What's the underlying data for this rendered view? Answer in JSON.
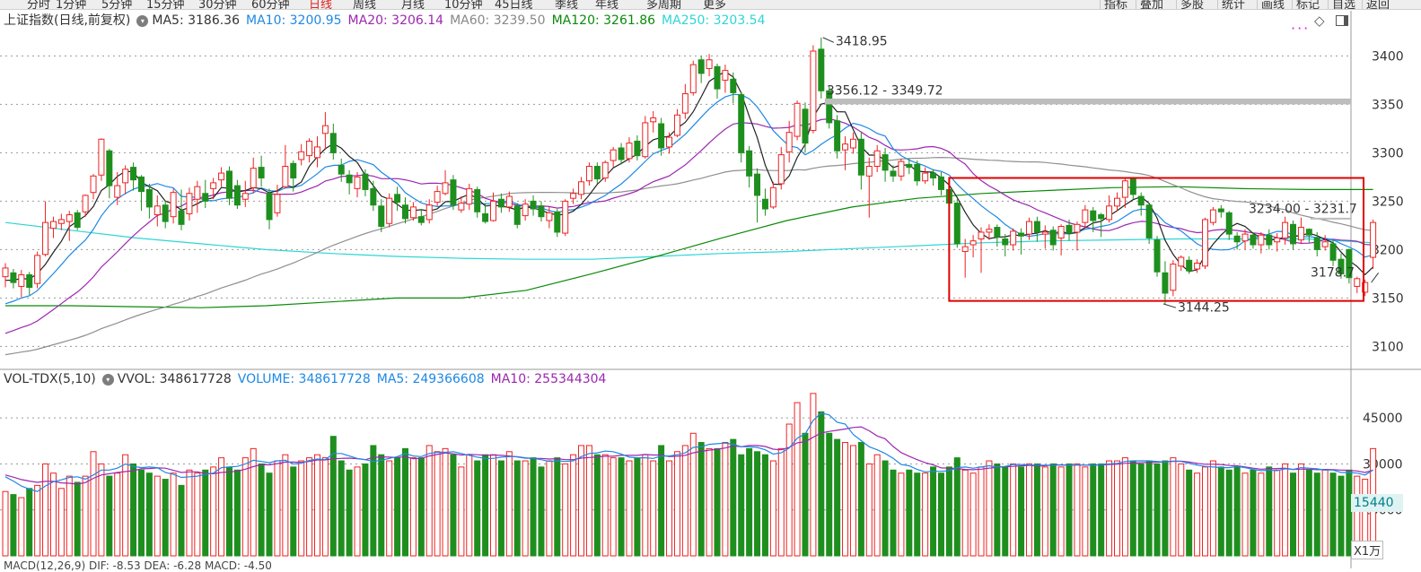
{
  "toolbar": {
    "tabs": [
      "分时",
      "1分钟",
      "5分钟",
      "15分钟",
      "30分钟",
      "60分钟",
      "日线",
      "周线",
      "月线",
      "10分钟",
      "45日线",
      "季线",
      "年线",
      "多周期",
      "更多"
    ],
    "active_tab": "日线",
    "right_buttons": [
      "指标",
      "叠加",
      "多股",
      "统计",
      "画线",
      "标记",
      "自选",
      "返回"
    ]
  },
  "price_panel": {
    "legend": [
      {
        "text": "上证指数(日线,前复权)",
        "color": "#333333"
      },
      {
        "text": "MA5: 3186.36",
        "color": "#333333"
      },
      {
        "text": "MA10: 3200.95",
        "color": "#1e88e5"
      },
      {
        "text": "MA20: 3206.14",
        "color": "#9c27b0"
      },
      {
        "text": "MA60: 3239.50",
        "color": "#888888"
      },
      {
        "text": "MA120: 3261.86",
        "color": "#0a8a0a"
      },
      {
        "text": "MA250: 3203.54",
        "color": "#2ed5d5"
      }
    ],
    "ticks": [
      "3400",
      "3350",
      "3300",
      "3250",
      "3200",
      "3150",
      "3100"
    ],
    "annotations": {
      "high": "3418.95",
      "gap_upper": "3356.12 - 3349.72",
      "gap_right": "3234.00 - 3231.7",
      "low": "3144.25",
      "last": "3178.7"
    }
  },
  "volume_panel": {
    "legend": [
      {
        "text": "VOL-TDX(5,10)",
        "color": "#333333"
      },
      {
        "text": "VVOL: 348617728",
        "color": "#333333"
      },
      {
        "text": "VOLUME: 348617728",
        "color": "#1e88e5"
      },
      {
        "text": "MA5: 249366608",
        "color": "#1e88e5"
      },
      {
        "text": "MA10: 255344304",
        "color": "#9c27b0"
      }
    ],
    "ticks": [
      "45000",
      "30000",
      "15000"
    ],
    "current_marker": "15440",
    "unit_label": "X1万"
  },
  "bottom_legend": "MACD(12,26,9)  DIF: -8.53  DEA: -6.28  MACD: -4.50",
  "colors": {
    "up": "#ee2222",
    "down": "#1e8f1e",
    "box": "#e00000",
    "grid": "#9a9a9a",
    "ma5": "#222222",
    "ma10": "#1e88e5",
    "ma20": "#9c27b0",
    "ma60": "#8f8f8f",
    "ma120": "#0a8a0a",
    "ma250": "#2ed5d5"
  },
  "chart_data": {
    "type": "candlestick",
    "price_ylim": [
      3080,
      3430
    ],
    "volume_ylim": [
      0,
      55000
    ],
    "candles": [
      [
        3172,
        3181,
        3186,
        3161,
        21000
      ],
      [
        3176,
        3166,
        3180,
        3160,
        20000
      ],
      [
        3162,
        3174,
        3179,
        3151,
        19000
      ],
      [
        3174,
        3161,
        3177,
        3153,
        22000
      ],
      [
        3165,
        3194,
        3198,
        3160,
        23000
      ],
      [
        3195,
        3228,
        3250,
        3193,
        30000
      ],
      [
        3222,
        3229,
        3234,
        3212,
        27000
      ],
      [
        3227,
        3231,
        3237,
        3220,
        22000
      ],
      [
        3229,
        3236,
        3240,
        3209,
        26000
      ],
      [
        3238,
        3223,
        3241,
        3220,
        24000
      ],
      [
        3239,
        3256,
        3257,
        3234,
        26000
      ],
      [
        3259,
        3276,
        3278,
        3252,
        34000
      ],
      [
        3277,
        3314,
        3315,
        3271,
        30000
      ],
      [
        3302,
        3266,
        3304,
        3253,
        26000
      ],
      [
        3254,
        3266,
        3280,
        3246,
        27000
      ],
      [
        3269,
        3283,
        3287,
        3257,
        33000
      ],
      [
        3285,
        3272,
        3290,
        3261,
        30000
      ],
      [
        3275,
        3260,
        3277,
        3240,
        28000
      ],
      [
        3262,
        3244,
        3268,
        3232,
        27000
      ],
      [
        3236,
        3245,
        3256,
        3224,
        26000
      ],
      [
        3246,
        3229,
        3251,
        3222,
        25000
      ],
      [
        3234,
        3259,
        3263,
        3227,
        27000
      ],
      [
        3240,
        3226,
        3262,
        3220,
        23000
      ],
      [
        3237,
        3258,
        3264,
        3230,
        28000
      ],
      [
        3252,
        3265,
        3271,
        3238,
        27000
      ],
      [
        3258,
        3250,
        3272,
        3243,
        28000
      ],
      [
        3263,
        3269,
        3274,
        3252,
        29000
      ],
      [
        3272,
        3279,
        3285,
        3265,
        32000
      ],
      [
        3281,
        3253,
        3286,
        3246,
        29000
      ],
      [
        3266,
        3246,
        3272,
        3242,
        28000
      ],
      [
        3252,
        3258,
        3271,
        3244,
        32000
      ],
      [
        3264,
        3284,
        3295,
        3258,
        35000
      ],
      [
        3285,
        3274,
        3297,
        3265,
        30000
      ],
      [
        3258,
        3231,
        3263,
        3221,
        27000
      ],
      [
        3238,
        3257,
        3267,
        3234,
        31000
      ],
      [
        3265,
        3286,
        3308,
        3263,
        33000
      ],
      [
        3289,
        3274,
        3292,
        3260,
        29000
      ],
      [
        3293,
        3301,
        3309,
        3287,
        31000
      ],
      [
        3297,
        3312,
        3315,
        3290,
        32000
      ],
      [
        3295,
        3306,
        3317,
        3285,
        33000
      ],
      [
        3320,
        3328,
        3342,
        3303,
        32000
      ],
      [
        3320,
        3300,
        3330,
        3293,
        39000
      ],
      [
        3287,
        3278,
        3294,
        3270,
        31000
      ],
      [
        3277,
        3269,
        3282,
        3257,
        28000
      ],
      [
        3263,
        3275,
        3280,
        3254,
        29000
      ],
      [
        3278,
        3262,
        3283,
        3255,
        30000
      ],
      [
        3263,
        3246,
        3271,
        3240,
        36000
      ],
      [
        3245,
        3224,
        3252,
        3218,
        33000
      ],
      [
        3227,
        3253,
        3258,
        3223,
        31000
      ],
      [
        3257,
        3249,
        3265,
        3240,
        32000
      ],
      [
        3246,
        3232,
        3254,
        3227,
        35000
      ],
      [
        3233,
        3244,
        3249,
        3230,
        32000
      ],
      [
        3234,
        3228,
        3242,
        3225,
        32000
      ],
      [
        3231,
        3246,
        3252,
        3227,
        36000
      ],
      [
        3249,
        3260,
        3266,
        3245,
        34000
      ],
      [
        3258,
        3269,
        3282,
        3256,
        35000
      ],
      [
        3272,
        3246,
        3277,
        3241,
        33000
      ],
      [
        3241,
        3248,
        3255,
        3238,
        29000
      ],
      [
        3247,
        3263,
        3268,
        3241,
        33000
      ],
      [
        3262,
        3239,
        3265,
        3233,
        31000
      ],
      [
        3237,
        3229,
        3248,
        3227,
        33000
      ],
      [
        3230,
        3250,
        3259,
        3229,
        33000
      ],
      [
        3252,
        3244,
        3258,
        3238,
        31000
      ],
      [
        3244,
        3255,
        3260,
        3239,
        34000
      ],
      [
        3245,
        3226,
        3248,
        3222,
        31000
      ],
      [
        3235,
        3247,
        3252,
        3230,
        31000
      ],
      [
        3250,
        3242,
        3256,
        3235,
        32000
      ],
      [
        3245,
        3234,
        3250,
        3229,
        29000
      ],
      [
        3230,
        3238,
        3244,
        3222,
        31000
      ],
      [
        3239,
        3218,
        3242,
        3213,
        32000
      ],
      [
        3217,
        3250,
        3252,
        3214,
        30000
      ],
      [
        3253,
        3258,
        3263,
        3247,
        33000
      ],
      [
        3257,
        3270,
        3275,
        3252,
        36000
      ],
      [
        3271,
        3286,
        3290,
        3266,
        36000
      ],
      [
        3286,
        3273,
        3290,
        3268,
        33000
      ],
      [
        3274,
        3290,
        3292,
        3270,
        33000
      ],
      [
        3292,
        3303,
        3306,
        3285,
        32000
      ],
      [
        3305,
        3293,
        3310,
        3288,
        32000
      ],
      [
        3294,
        3310,
        3316,
        3290,
        31000
      ],
      [
        3312,
        3297,
        3318,
        3292,
        32000
      ],
      [
        3296,
        3331,
        3338,
        3294,
        33000
      ],
      [
        3332,
        3336,
        3343,
        3321,
        31000
      ],
      [
        3330,
        3305,
        3336,
        3297,
        36000
      ],
      [
        3306,
        3316,
        3321,
        3299,
        31000
      ],
      [
        3318,
        3339,
        3345,
        3316,
        34000
      ],
      [
        3341,
        3361,
        3371,
        3335,
        36000
      ],
      [
        3362,
        3391,
        3395,
        3359,
        40000
      ],
      [
        3396,
        3382,
        3400,
        3372,
        37000
      ],
      [
        3387,
        3396,
        3402,
        3379,
        35000
      ],
      [
        3389,
        3366,
        3392,
        3356,
        35000
      ],
      [
        3375,
        3385,
        3391,
        3362,
        37000
      ],
      [
        3376,
        3362,
        3383,
        3351,
        38000
      ],
      [
        3360,
        3300,
        3363,
        3290,
        33000
      ],
      [
        3302,
        3276,
        3307,
        3264,
        35000
      ],
      [
        3278,
        3256,
        3284,
        3228,
        34000
      ],
      [
        3252,
        3242,
        3263,
        3235,
        33000
      ],
      [
        3244,
        3264,
        3270,
        3242,
        31000
      ],
      [
        3268,
        3298,
        3306,
        3262,
        35000
      ],
      [
        3301,
        3321,
        3333,
        3290,
        43000
      ],
      [
        3317,
        3351,
        3354,
        3313,
        50000
      ],
      [
        3345,
        3310,
        3352,
        3300,
        40000
      ],
      [
        3323,
        3405,
        3411,
        3320,
        53000
      ],
      [
        3407,
        3364,
        3419,
        3356,
        47000
      ],
      [
        3364,
        3331,
        3369,
        3325,
        40000
      ],
      [
        3333,
        3302,
        3339,
        3294,
        38000
      ],
      [
        3303,
        3309,
        3317,
        3282,
        37000
      ],
      [
        3305,
        3314,
        3321,
        3299,
        36000
      ],
      [
        3314,
        3277,
        3321,
        3262,
        37000
      ],
      [
        3276,
        3286,
        3295,
        3233,
        30000
      ],
      [
        3286,
        3302,
        3308,
        3280,
        33000
      ],
      [
        3298,
        3282,
        3305,
        3270,
        31000
      ],
      [
        3281,
        3276,
        3287,
        3270,
        28000
      ],
      [
        3276,
        3291,
        3294,
        3271,
        27000
      ],
      [
        3288,
        3285,
        3294,
        3278,
        28000
      ],
      [
        3288,
        3271,
        3292,
        3266,
        27000
      ],
      [
        3271,
        3279,
        3285,
        3268,
        27000
      ],
      [
        3279,
        3274,
        3283,
        3266,
        29000
      ],
      [
        3275,
        3262,
        3280,
        3256,
        27000
      ],
      [
        3262,
        3248,
        3266,
        3244,
        29000
      ],
      [
        3248,
        3206,
        3252,
        3202,
        32000
      ],
      [
        3198,
        3203,
        3211,
        3171,
        28000
      ],
      [
        3205,
        3209,
        3215,
        3192,
        27000
      ],
      [
        3211,
        3218,
        3223,
        3176,
        29000
      ],
      [
        3218,
        3221,
        3226,
        3210,
        31000
      ],
      [
        3223,
        3213,
        3226,
        3203,
        30000
      ],
      [
        3211,
        3205,
        3216,
        3193,
        29000
      ],
      [
        3205,
        3219,
        3222,
        3199,
        30000
      ],
      [
        3217,
        3214,
        3222,
        3195,
        29000
      ],
      [
        3216,
        3229,
        3233,
        3210,
        30000
      ],
      [
        3229,
        3218,
        3234,
        3208,
        30000
      ],
      [
        3216,
        3218,
        3225,
        3201,
        29000
      ],
      [
        3220,
        3205,
        3224,
        3199,
        30000
      ],
      [
        3212,
        3224,
        3226,
        3194,
        29000
      ],
      [
        3225,
        3217,
        3231,
        3209,
        30000
      ],
      [
        3218,
        3226,
        3229,
        3199,
        30000
      ],
      [
        3228,
        3241,
        3246,
        3222,
        29000
      ],
      [
        3240,
        3230,
        3244,
        3218,
        30000
      ],
      [
        3236,
        3232,
        3238,
        3213,
        30000
      ],
      [
        3231,
        3245,
        3256,
        3228,
        31000
      ],
      [
        3245,
        3253,
        3259,
        3240,
        31000
      ],
      [
        3254,
        3271,
        3274,
        3243,
        32000
      ],
      [
        3273,
        3257,
        3275,
        3252,
        31000
      ],
      [
        3255,
        3246,
        3259,
        3235,
        30000
      ],
      [
        3246,
        3212,
        3248,
        3206,
        31000
      ],
      [
        3210,
        3177,
        3214,
        3172,
        30000
      ],
      [
        3176,
        3155,
        3188,
        3144,
        31000
      ],
      [
        3158,
        3185,
        3189,
        3152,
        32000
      ],
      [
        3183,
        3192,
        3194,
        3178,
        30000
      ],
      [
        3189,
        3178,
        3193,
        3175,
        28000
      ],
      [
        3180,
        3186,
        3190,
        3176,
        27000
      ],
      [
        3183,
        3231,
        3233,
        3180,
        29000
      ],
      [
        3228,
        3241,
        3244,
        3225,
        31000
      ],
      [
        3242,
        3239,
        3246,
        3233,
        29000
      ],
      [
        3238,
        3216,
        3240,
        3210,
        28000
      ],
      [
        3214,
        3208,
        3218,
        3200,
        29000
      ],
      [
        3209,
        3216,
        3221,
        3200,
        27000
      ],
      [
        3215,
        3205,
        3218,
        3201,
        28000
      ],
      [
        3205,
        3215,
        3218,
        3196,
        27000
      ],
      [
        3215,
        3205,
        3221,
        3200,
        29000
      ],
      [
        3208,
        3212,
        3217,
        3198,
        28000
      ],
      [
        3212,
        3228,
        3234,
        3205,
        30000
      ],
      [
        3226,
        3206,
        3230,
        3200,
        27000
      ],
      [
        3210,
        3223,
        3233,
        3206,
        30000
      ],
      [
        3221,
        3215,
        3222,
        3207,
        28000
      ],
      [
        3212,
        3200,
        3218,
        3193,
        27000
      ],
      [
        3203,
        3208,
        3215,
        3199,
        28000
      ],
      [
        3206,
        3189,
        3210,
        3183,
        27000
      ],
      [
        3190,
        3175,
        3196,
        3170,
        26000
      ],
      [
        3200,
        3171,
        3201,
        3165,
        28000
      ],
      [
        3162,
        3170,
        3172,
        3155,
        26000
      ],
      [
        3156,
        3166,
        3169,
        3152,
        25000
      ],
      [
        3192,
        3228,
        3231,
        3180,
        35000
      ]
    ],
    "ma_series": [
      {
        "name": "MA5",
        "last": 3186.36
      },
      {
        "name": "MA10",
        "last": 3200.95
      },
      {
        "name": "MA20",
        "last": 3206.14
      },
      {
        "name": "MA60",
        "last": 3239.5
      },
      {
        "name": "MA120",
        "last": 3261.86,
        "values": [
          3142,
          3142,
          3141,
          3140,
          3142,
          3146,
          3150,
          3150,
          3158,
          3175,
          3193,
          3212,
          3230,
          3244,
          3253,
          3258,
          3261,
          3264,
          3265,
          3263,
          3262,
          3262
        ]
      },
      {
        "name": "MA250",
        "last": 3203.54,
        "values": [
          3228,
          3220,
          3212,
          3206,
          3200,
          3196,
          3193,
          3191,
          3190,
          3190,
          3193,
          3196,
          3198,
          3201,
          3204,
          3207,
          3209,
          3210,
          3211,
          3211,
          3211,
          3207
        ]
      }
    ],
    "volume_ma_series": [
      {
        "name": "MA5",
        "last": 249366608
      },
      {
        "name": "MA10",
        "last": 255344304
      }
    ]
  }
}
